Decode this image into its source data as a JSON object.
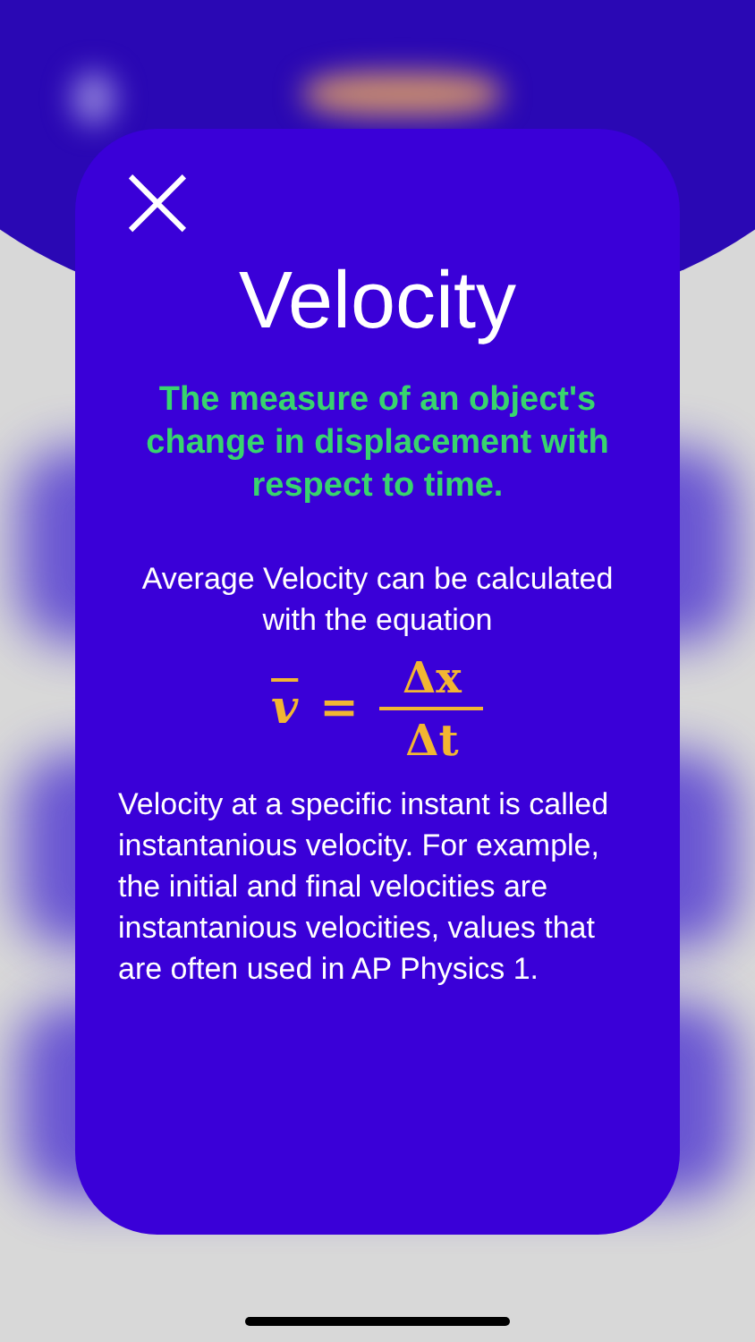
{
  "card": {
    "close_label": "×",
    "title": "Velocity",
    "definition": "The measure of an object's change in displacement with respect to time.",
    "intro": "Average Velocity can be calculated with the equation",
    "equation": {
      "lhs": "v",
      "lhs_bar": true,
      "equals": "=",
      "numerator": "Δx",
      "denominator": "Δt"
    },
    "body": "Velocity at a specific instant is called instantanious velocity. For example, the initial and final velocities are instantanious velocities, values that are often used in AP Physics 1."
  }
}
